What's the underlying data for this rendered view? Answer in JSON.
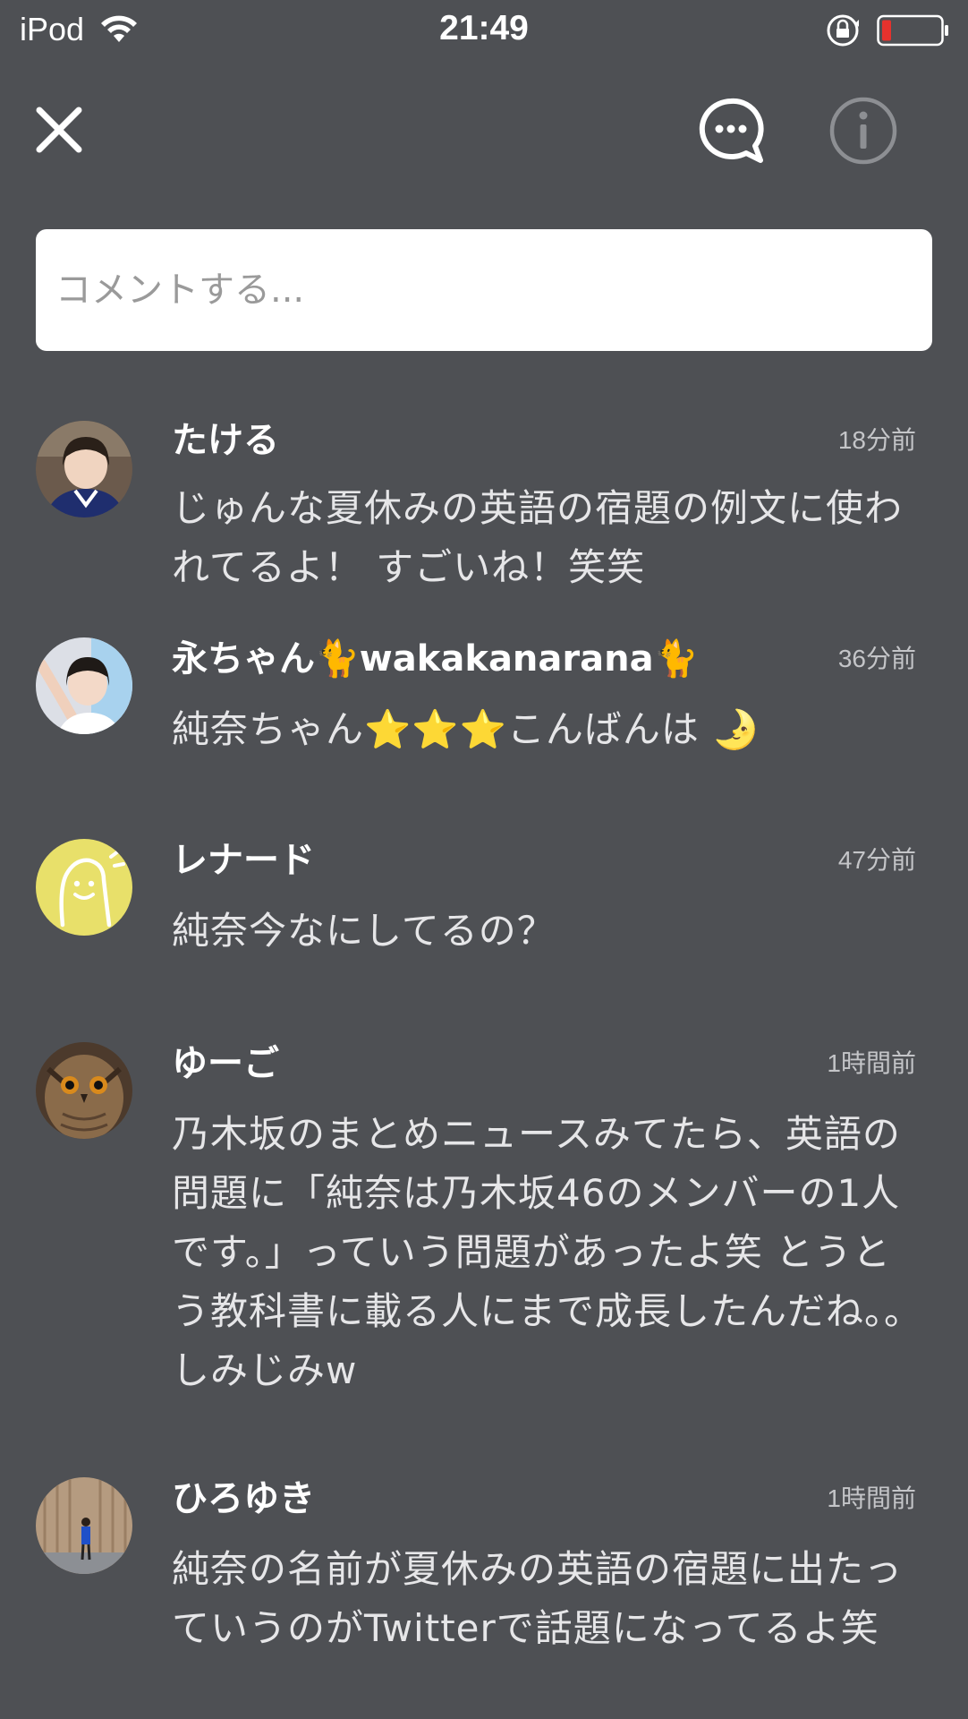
{
  "status_bar": {
    "carrier": "iPod",
    "time": "21:49"
  },
  "toolbar": {
    "close_icon": "close-icon",
    "chat_icon": "chat-bubble-icon",
    "info_icon": "info-icon"
  },
  "comment_input": {
    "placeholder": "コメントする..."
  },
  "comments": [
    {
      "name": "たける",
      "time": "18分前",
      "text": "じゅんな夏休みの英語の宿題の例文に使われてるよ！ すごいね！笑笑",
      "avatar": "photo-avatar"
    },
    {
      "name": "永ちゃん🐈wakakanarana🐈",
      "time": "36分前",
      "text": "純奈ちゃん⭐⭐⭐こんばんは 🌛",
      "avatar": "photo-avatar"
    },
    {
      "name": "レナード",
      "time": "47分前",
      "text": "純奈今なにしてるの？",
      "avatar": "default-face-avatar"
    },
    {
      "name": "ゆーご",
      "time": "1時間前",
      "text": "乃木坂のまとめニュースみてたら、英語の問題に「純奈は乃木坂46のメンバーの1人です。」っていう問題があったよ笑 とうとう教科書に載る人にまで成長したんだね。。しみじみw",
      "avatar": "owl-photo-avatar"
    },
    {
      "name": "ひろゆき",
      "time": "1時間前",
      "text": "純奈の名前が夏休みの英語の宿題に出たっていうのがTwitterで話題になってるよ笑",
      "avatar": "photo-avatar"
    }
  ],
  "colors": {
    "background": "#4e5054",
    "avatar_default": "#e8e06a",
    "battery_low": "#e5322d"
  }
}
